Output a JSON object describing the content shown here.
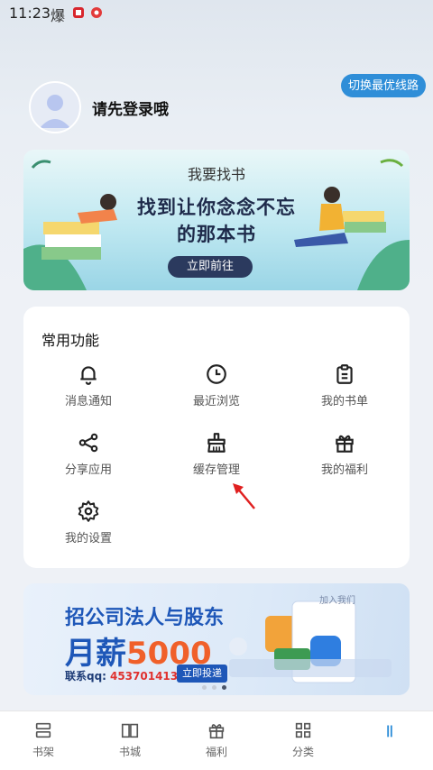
{
  "status_bar": {
    "time": "11:23",
    "icons": [
      "fire-icon",
      "app-badge-icon",
      "notification-icon"
    ]
  },
  "header": {
    "switch_route_label": "切换最优线路"
  },
  "profile": {
    "login_prompt": "请先登录哦"
  },
  "banner": {
    "small_title": "我要找书",
    "title_line1": "找到让你念念不忘",
    "title_line2": "的那本书",
    "button_label": "立即前往"
  },
  "functions": {
    "title": "常用功能",
    "items": [
      {
        "label": "消息通知",
        "icon": "bell-icon"
      },
      {
        "label": "最近浏览",
        "icon": "clock-icon"
      },
      {
        "label": "我的书单",
        "icon": "clipboard-icon"
      },
      {
        "label": "分享应用",
        "icon": "share-icon"
      },
      {
        "label": "缓存管理",
        "icon": "broom-icon"
      },
      {
        "label": "我的福利",
        "icon": "gift-icon"
      },
      {
        "label": "我的设置",
        "icon": "gear-icon"
      }
    ]
  },
  "ad": {
    "line1": "招公司法人与股东",
    "line2_prefix": "月薪",
    "line2_amount": "5000",
    "contact_label": "联系qq:",
    "contact_qq": "453701413",
    "button_label": "立即投递",
    "join_text": "加入我们"
  },
  "tabs": [
    {
      "label": "书架",
      "icon": "bookshelf-icon"
    },
    {
      "label": "书城",
      "icon": "book-icon"
    },
    {
      "label": "福利",
      "icon": "gift-icon"
    },
    {
      "label": "分类",
      "icon": "grid-icon"
    },
    {
      "label": "",
      "icon": "profile-icon"
    }
  ],
  "colors": {
    "accent": "#2f8ed8",
    "ad_blue": "#1e57b8",
    "ad_orange": "#f0602a",
    "arrow": "#e02020"
  }
}
